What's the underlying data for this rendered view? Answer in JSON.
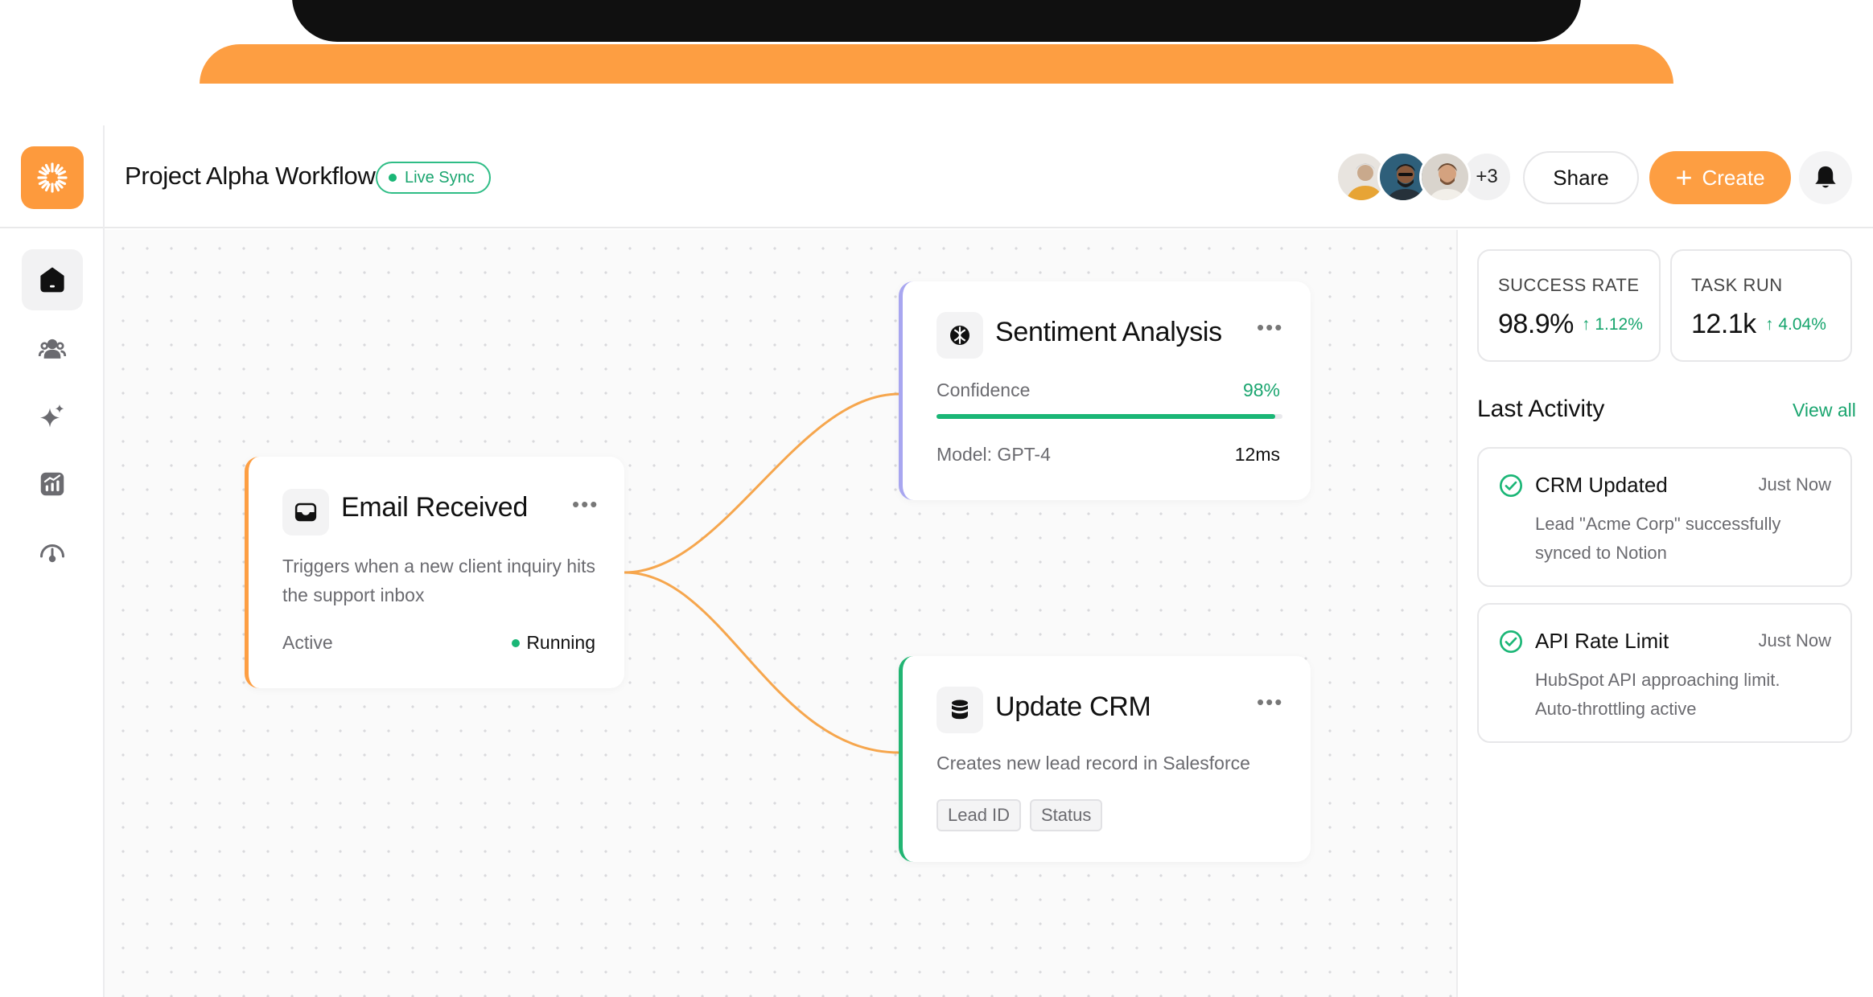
{
  "header": {
    "title": "Project Alpha Workflow",
    "live_badge": "Live Sync",
    "avatars_more": "+3",
    "share_label": "Share",
    "create_label": "Create"
  },
  "sidebar": {
    "items": [
      {
        "name": "home-icon",
        "active": true
      },
      {
        "name": "users-icon",
        "active": false
      },
      {
        "name": "sparkle-icon",
        "active": false
      },
      {
        "name": "analytics-icon",
        "active": false
      },
      {
        "name": "gauge-icon",
        "active": false
      }
    ]
  },
  "nodes": {
    "email": {
      "title": "Email Received",
      "description": "Triggers when a new client inquiry hits the support inbox",
      "status_label": "Active",
      "status_value": "Running"
    },
    "sentiment": {
      "title": "Sentiment Analysis",
      "confidence_label": "Confidence",
      "confidence_value": "98%",
      "confidence_fraction": 0.98,
      "model_label": "Model: GPT-4",
      "latency": "12ms"
    },
    "crm": {
      "title": "Update CRM",
      "description": "Creates new lead record in Salesforce",
      "tags": [
        "Lead ID",
        "Status"
      ]
    }
  },
  "stats": [
    {
      "label": "SUCCESS RATE",
      "value": "98.9%",
      "delta": "1.12%"
    },
    {
      "label": "TASK RUN",
      "value": "12.1k",
      "delta": "4.04%"
    }
  ],
  "activity": {
    "heading": "Last Activity",
    "view_all": "View all",
    "items": [
      {
        "title": "CRM Updated",
        "time": "Just Now",
        "desc": "Lead \"Acme Corp\" successfully synced to Notion"
      },
      {
        "title": "API Rate Limit",
        "time": "Just Now",
        "desc": "HubSpot API approaching limit. Auto-throttling active"
      }
    ]
  },
  "colors": {
    "accent": "#fd9e42",
    "success": "#1ab676",
    "sentiment_border": "#a8a6f0",
    "crm_border": "#22b573"
  }
}
